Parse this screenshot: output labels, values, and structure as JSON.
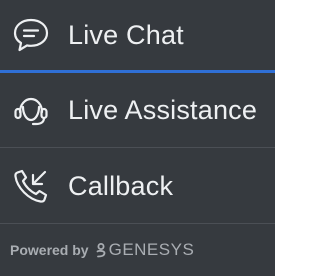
{
  "colors": {
    "background": "#363a3f",
    "accent": "#2f6fd6",
    "text": "#eef0f2",
    "footer_text": "#a9adb2"
  },
  "options": [
    {
      "label": "Live Chat",
      "icon": "chat-bubble-icon"
    },
    {
      "label": "Live Assistance",
      "icon": "headset-icon"
    },
    {
      "label": "Callback",
      "icon": "phone-callback-icon"
    }
  ],
  "footer": {
    "powered_by": "Powered by",
    "brand": "GENESYS",
    "brand_icon": "genesys-logo-icon"
  }
}
